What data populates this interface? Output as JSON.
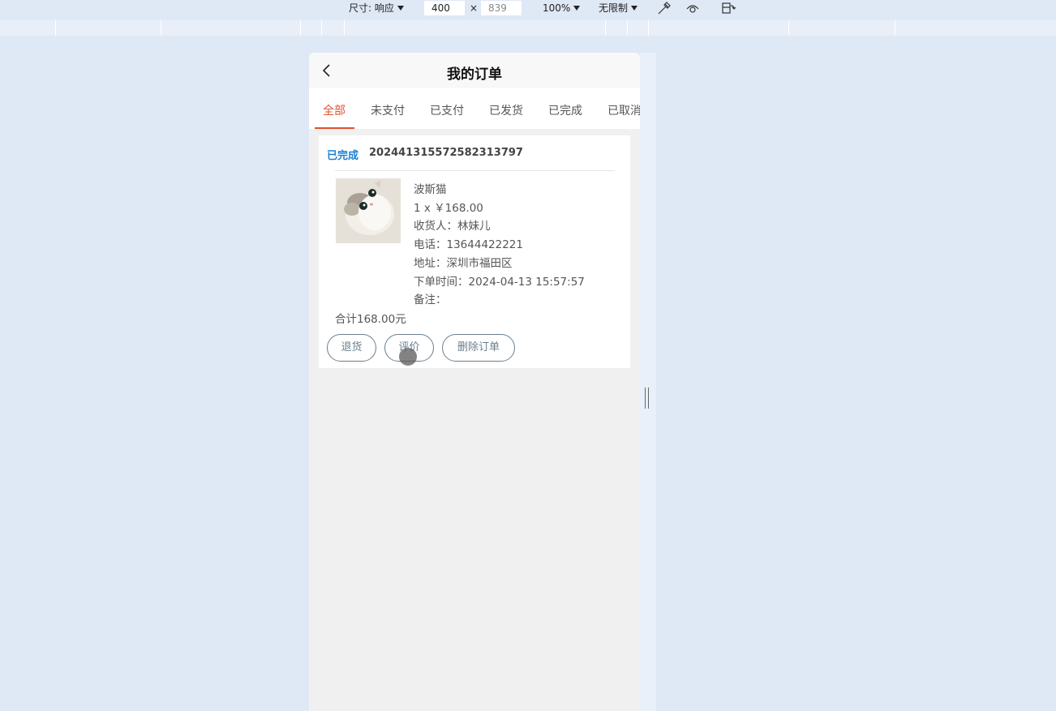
{
  "devtools": {
    "size_label": "尺寸: 响应",
    "width_value": "400",
    "times": "×",
    "height_value": "839",
    "zoom_label": "100%",
    "throttle_label": "无限制"
  },
  "page": {
    "title": "我的订单",
    "tabs": [
      "全部",
      "未支付",
      "已支付",
      "已发货",
      "已完成",
      "已取消"
    ],
    "active_tab": 0
  },
  "order": {
    "status": "已完成",
    "number": "20244131557258231379​7",
    "product_name": "波斯猫",
    "qty_price": "1 x ￥168.00",
    "receiver": "收货人：林妹儿",
    "phone": "电话：13644422221",
    "address": "地址：深圳市福田区",
    "order_time": "下单时间：2024-04-13 15:57:57",
    "remark": "备注：",
    "total": "合计168.00元",
    "buttons": {
      "refund": "退货",
      "review": "评价",
      "delete": "删除订单"
    }
  },
  "colors": {
    "accent": "#e0532b",
    "status_blue": "#1a7fd4",
    "button_border": "#6a7f8e"
  }
}
